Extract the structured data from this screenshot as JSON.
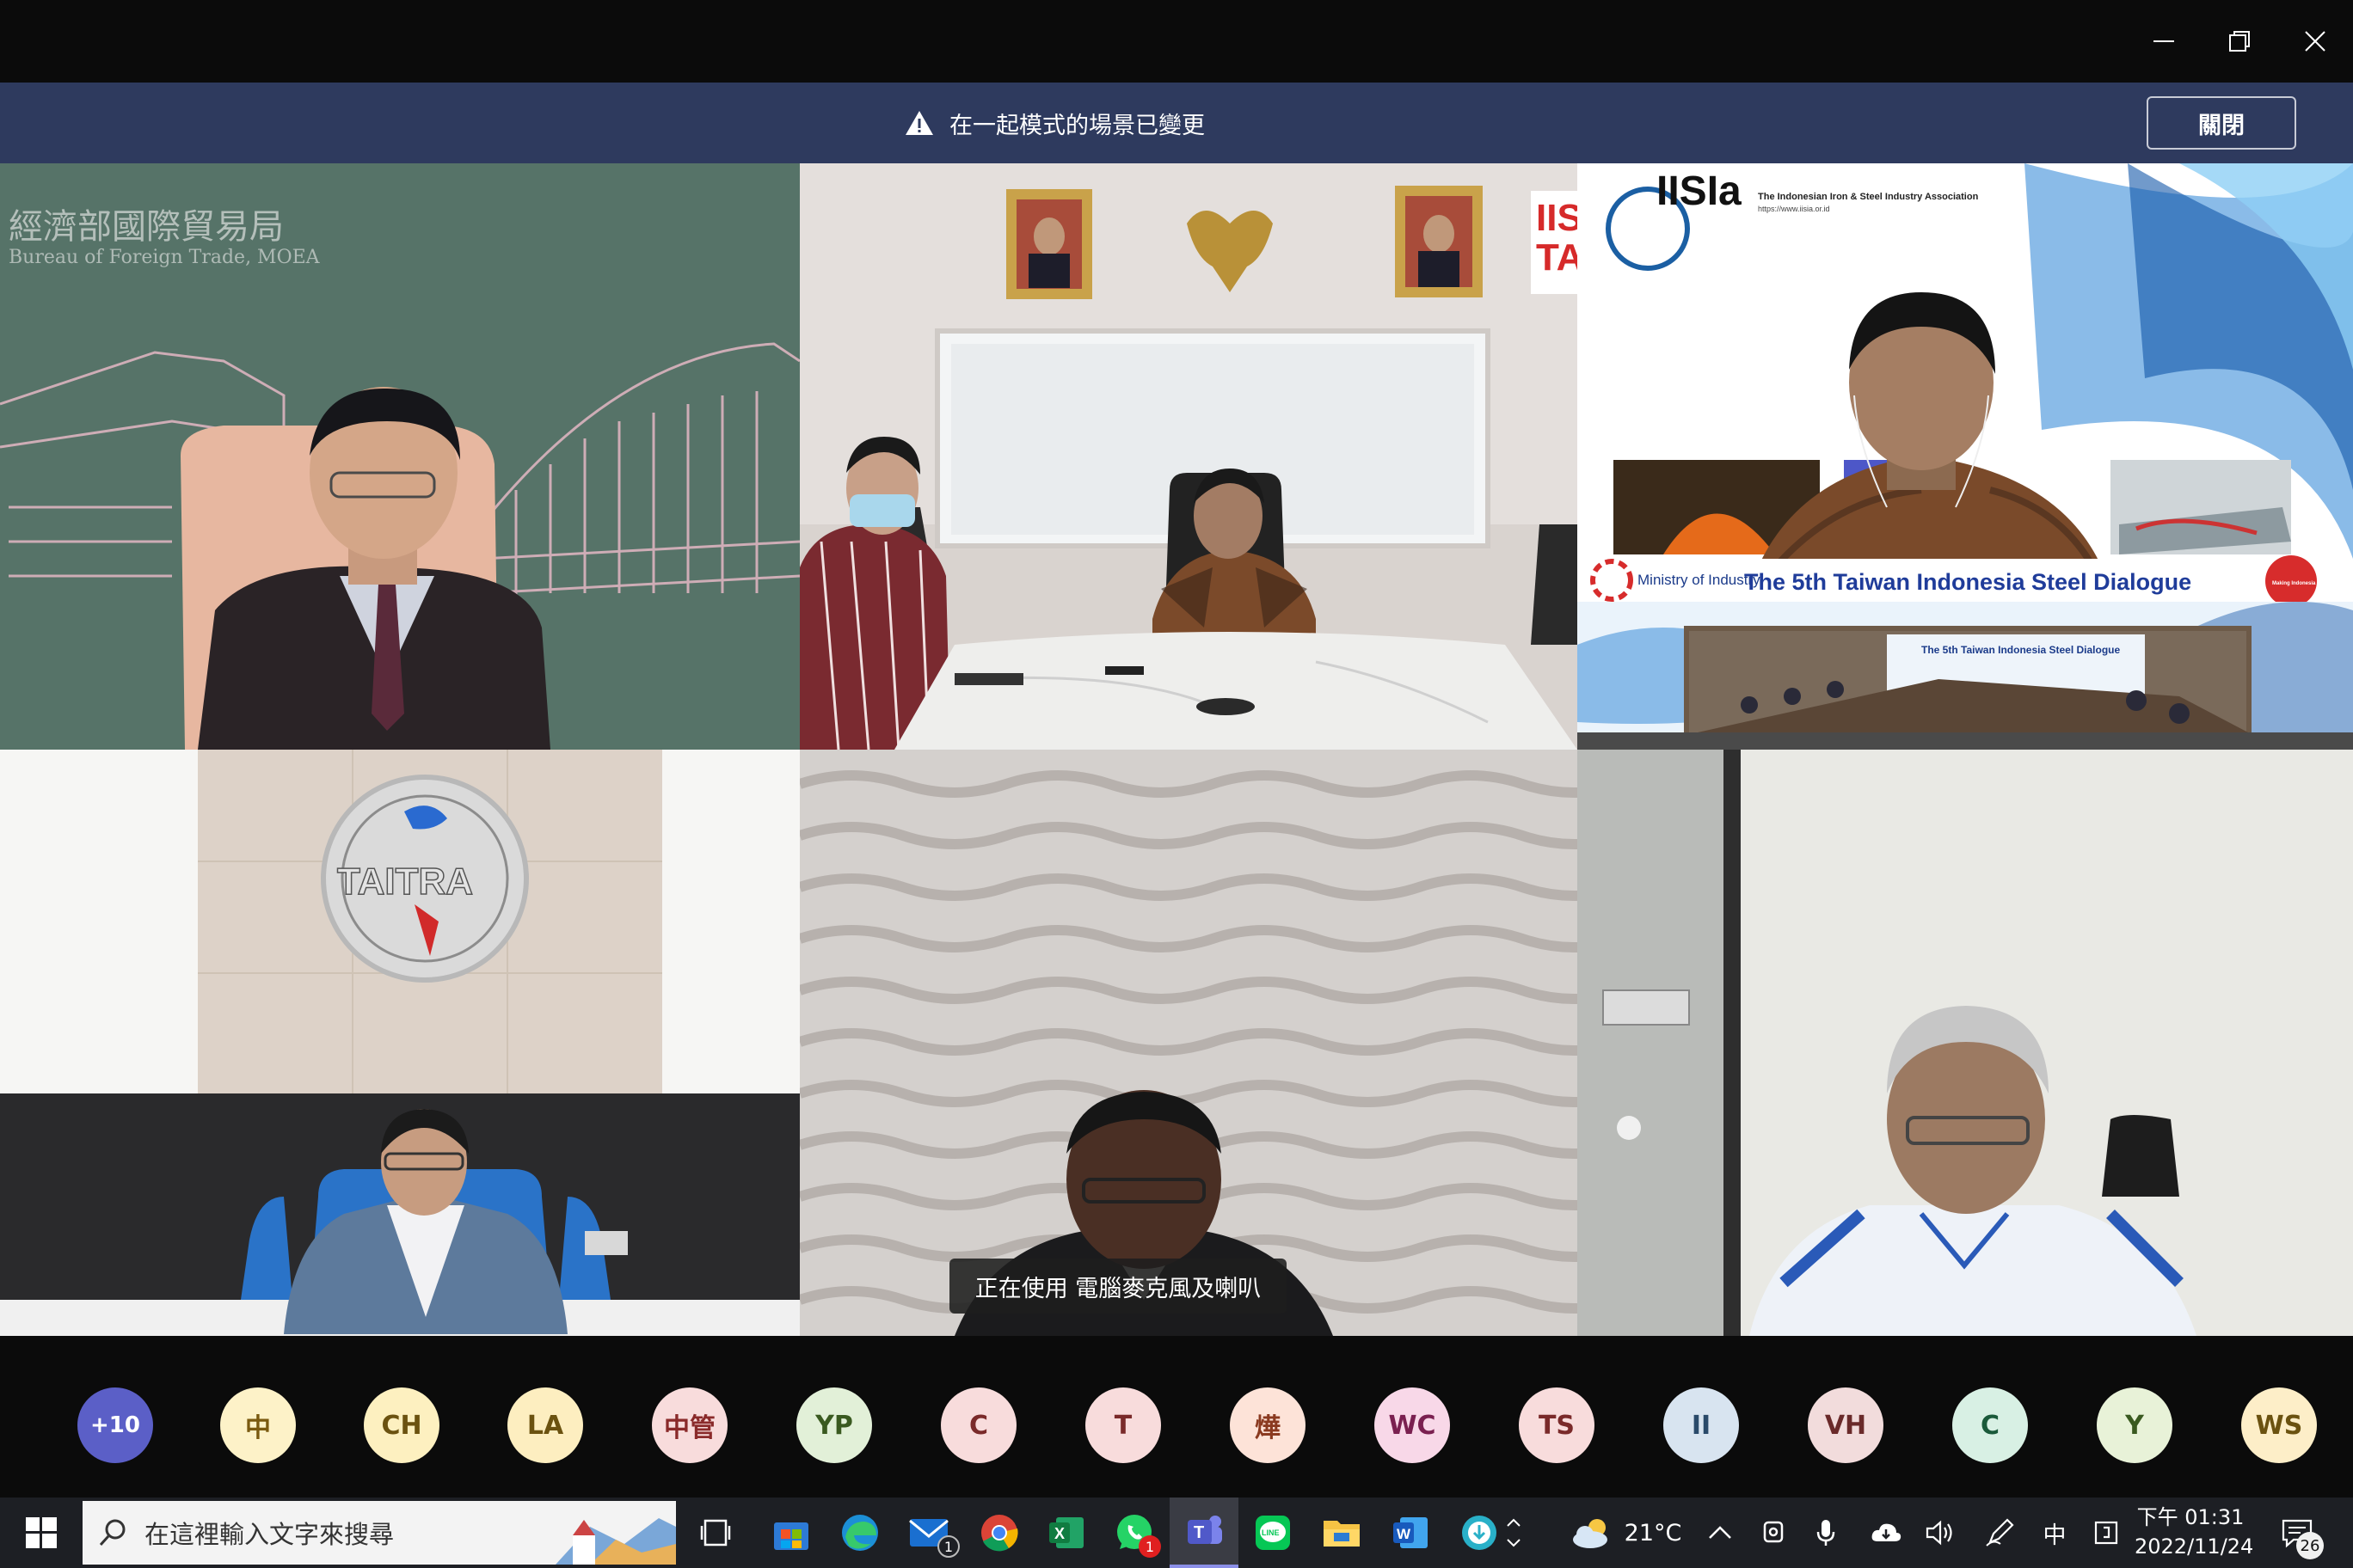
{
  "banner": {
    "message": "在一起模式的場景已變更",
    "close_label": "關閉"
  },
  "tiles": {
    "bureau": {
      "chinese_name": "經濟部國際貿易局",
      "english_name": "Bureau of Foreign Trade, MOEA"
    },
    "conference_room": {
      "sign_text": "IIS\nTA"
    },
    "iisia": {
      "logo_text": "IISIa",
      "assoc_name": "The Indonesian Iron & Steel Industry Association",
      "assoc_url": "https://www.iisia.or.id",
      "ministry": "Ministry of Industry",
      "dialogue_title": "The 5th Taiwan Indonesia Steel Dialogue",
      "making_indonesia": "Making Indonesia 4.0",
      "inner_title": "The 5th Taiwan Indonesia Steel Dialogue"
    },
    "taitra": {
      "logo_text": "TAITRA"
    },
    "speaker_toast": "正在使用 電腦麥克風及喇叭"
  },
  "participants": [
    {
      "initials": "+10",
      "bg": "#5b5fc7",
      "fg": "#ffffff"
    },
    {
      "initials": "中",
      "bg": "#fdf2c8",
      "fg": "#7a5a10"
    },
    {
      "initials": "CH",
      "bg": "#fdf0c0",
      "fg": "#6b5210"
    },
    {
      "initials": "LA",
      "bg": "#fdeec0",
      "fg": "#6b5210"
    },
    {
      "initials": "中管",
      "bg": "#f8dcdc",
      "fg": "#8a2a2a"
    },
    {
      "initials": "YP",
      "bg": "#e2f0d8",
      "fg": "#3a5a20"
    },
    {
      "initials": "C",
      "bg": "#f8dcdc",
      "fg": "#7a2a2a"
    },
    {
      "initials": "T",
      "bg": "#f8dcdc",
      "fg": "#7a2a2a"
    },
    {
      "initials": "燁",
      "bg": "#fde3d8",
      "fg": "#8a3a20"
    },
    {
      "initials": "WC",
      "bg": "#f8d8e8",
      "fg": "#7a2050"
    },
    {
      "initials": "TS",
      "bg": "#f8dcdc",
      "fg": "#7a2a2a"
    },
    {
      "initials": "II",
      "bg": "#d8e4f0",
      "fg": "#2a4a6a"
    },
    {
      "initials": "VH",
      "bg": "#f2dcdc",
      "fg": "#6a2a2a"
    },
    {
      "initials": "C",
      "bg": "#d8f0e4",
      "fg": "#1a5a3a"
    },
    {
      "initials": "Y",
      "bg": "#e8f2d8",
      "fg": "#3a5a20"
    },
    {
      "initials": "WS",
      "bg": "#fdeec8",
      "fg": "#6b5210"
    }
  ],
  "taskbar": {
    "search_placeholder": "在這裡輸入文字來搜尋",
    "weather": "21°C",
    "ime": "中",
    "time": "下午 01:31",
    "date": "2022/11/24",
    "mail_badge": "1",
    "whatsapp_badge": "1",
    "notification_count": "26",
    "excel_letter": "X",
    "teams_letter": "T",
    "line_text": "LINE",
    "word_letter": "W"
  },
  "colors": {
    "banner": "#2e3a5e",
    "taskbar": "#1d1f24",
    "teams_purple": "#5b5fc7"
  }
}
